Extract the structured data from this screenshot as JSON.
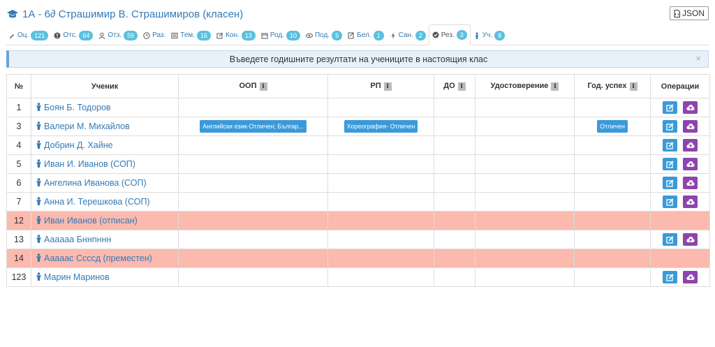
{
  "header": {
    "title": "1А - 6∂ Страшимир В. Страшимиров (класен)",
    "json_label": "JSON"
  },
  "tabs": [
    {
      "label": "Оц.",
      "badge": "121",
      "icon": "pencil-icon"
    },
    {
      "label": "Отс.",
      "badge": "64",
      "icon": "exclamation-icon"
    },
    {
      "label": "Отз.",
      "badge": "59",
      "icon": "users-icon"
    },
    {
      "label": "Раз.",
      "badge": "",
      "icon": "clock-icon"
    },
    {
      "label": "Тем.",
      "badge": "16",
      "icon": "list-icon"
    },
    {
      "label": "Кон.",
      "badge": "13",
      "icon": "edit-icon"
    },
    {
      "label": "Род.",
      "badge": "10",
      "icon": "calendar-icon"
    },
    {
      "label": "Под.",
      "badge": "5",
      "icon": "eye-icon"
    },
    {
      "label": "Бел.",
      "badge": "1",
      "icon": "note-icon"
    },
    {
      "label": "Сан.",
      "badge": "2",
      "icon": "bolt-icon"
    },
    {
      "label": "Рез.",
      "badge": "3",
      "icon": "check-circle-icon",
      "active": true
    },
    {
      "label": "Уч.",
      "badge": "8",
      "icon": "student-icon"
    }
  ],
  "alert": {
    "text": "Въведете годишните резултати на учениците в настоящия клас",
    "close": "×"
  },
  "table": {
    "headers": {
      "num": "№",
      "student": "Ученик",
      "oop": "ООП",
      "rp": "РП",
      "do": "ДО",
      "cert": "Удостоверение",
      "success": "Год. успех",
      "ops": "Операции"
    },
    "rows": [
      {
        "num": "1",
        "name": "Боян Б. Тодоров",
        "oop": "",
        "rp": "",
        "success": "",
        "red": false
      },
      {
        "num": "3",
        "name": "Валери М. Михайлов",
        "oop": "Английски език-Отличен; Българ...",
        "rp": "Хореография- Отличен",
        "success": "Отличен",
        "red": false
      },
      {
        "num": "4",
        "name": "Добрин Д. Хайне",
        "oop": "",
        "rp": "",
        "success": "",
        "red": false
      },
      {
        "num": "5",
        "name": "Иван И. Иванов (СОП)",
        "oop": "",
        "rp": "",
        "success": "",
        "red": false
      },
      {
        "num": "6",
        "name": "Ангелина Иванова (СОП)",
        "oop": "",
        "rp": "",
        "success": "",
        "red": false
      },
      {
        "num": "7",
        "name": "Анна И. Терешкова (СОП)",
        "oop": "",
        "rp": "",
        "success": "",
        "red": false
      },
      {
        "num": "12",
        "name": "Иван Иванов (отписан)",
        "oop": "",
        "rp": "",
        "success": "",
        "red": true
      },
      {
        "num": "13",
        "name": "Аааааа Бннnннн",
        "oop": "",
        "rp": "",
        "success": "",
        "red": false
      },
      {
        "num": "14",
        "name": "Аааааc Ссссд (преместен)",
        "oop": "",
        "rp": "",
        "success": "",
        "red": true
      },
      {
        "num": "123",
        "name": "Марин Маринов",
        "oop": "",
        "rp": "",
        "success": "",
        "red": false
      }
    ]
  }
}
